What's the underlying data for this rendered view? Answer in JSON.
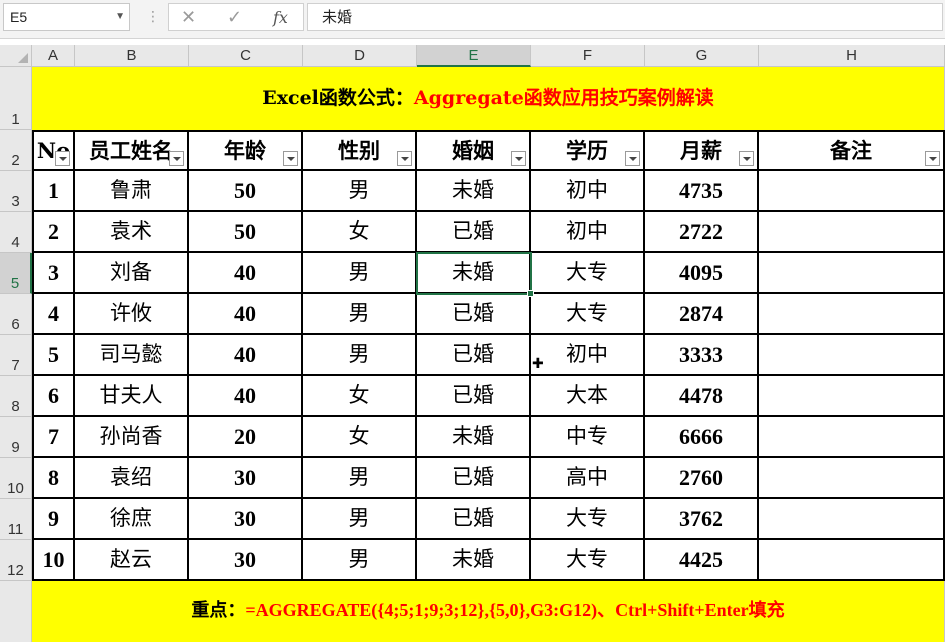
{
  "formula_bar": {
    "name_box": "E5",
    "fx_label": "fx",
    "cancel_glyph": "✕",
    "enter_glyph": "✓",
    "formula": "未婚"
  },
  "sheet": {
    "columns": [
      "A",
      "B",
      "C",
      "D",
      "E",
      "F",
      "G",
      "H"
    ],
    "rows": [
      "1",
      "2",
      "3",
      "4",
      "5",
      "6",
      "7",
      "8",
      "9",
      "10",
      "11",
      "12"
    ],
    "selected_col": "E",
    "selected_row": "5"
  },
  "title": {
    "black": "Excel函数公式：",
    "red": "Aggregate函数应用技巧案例解读"
  },
  "table": {
    "headers": [
      "No",
      "员工姓名",
      "年龄",
      "性别",
      "婚姻",
      "学历",
      "月薪",
      "备注"
    ],
    "rows": [
      [
        "1",
        "鲁肃",
        "50",
        "男",
        "未婚",
        "初中",
        "4735",
        ""
      ],
      [
        "2",
        "袁术",
        "50",
        "女",
        "已婚",
        "初中",
        "2722",
        ""
      ],
      [
        "3",
        "刘备",
        "40",
        "男",
        "未婚",
        "大专",
        "4095",
        ""
      ],
      [
        "4",
        "许攸",
        "40",
        "男",
        "已婚",
        "大专",
        "2874",
        ""
      ],
      [
        "5",
        "司马懿",
        "40",
        "男",
        "已婚",
        "初中",
        "3333",
        ""
      ],
      [
        "6",
        "甘夫人",
        "40",
        "女",
        "已婚",
        "大本",
        "4478",
        ""
      ],
      [
        "7",
        "孙尚香",
        "20",
        "女",
        "未婚",
        "中专",
        "6666",
        ""
      ],
      [
        "8",
        "袁绍",
        "30",
        "男",
        "已婚",
        "高中",
        "2760",
        ""
      ],
      [
        "9",
        "徐庶",
        "30",
        "男",
        "已婚",
        "大专",
        "3762",
        ""
      ],
      [
        "10",
        "赵云",
        "30",
        "男",
        "未婚",
        "大专",
        "4425",
        ""
      ]
    ]
  },
  "footer": {
    "black": "重点：",
    "red": "=AGGREGATE({4;5;1;9;3;12},{5,0},G3:G12)、Ctrl+Shift+Enter填充"
  },
  "colors": {
    "banner": "#ffff00",
    "accent_red": "#ff0000",
    "selection": "#217346"
  }
}
